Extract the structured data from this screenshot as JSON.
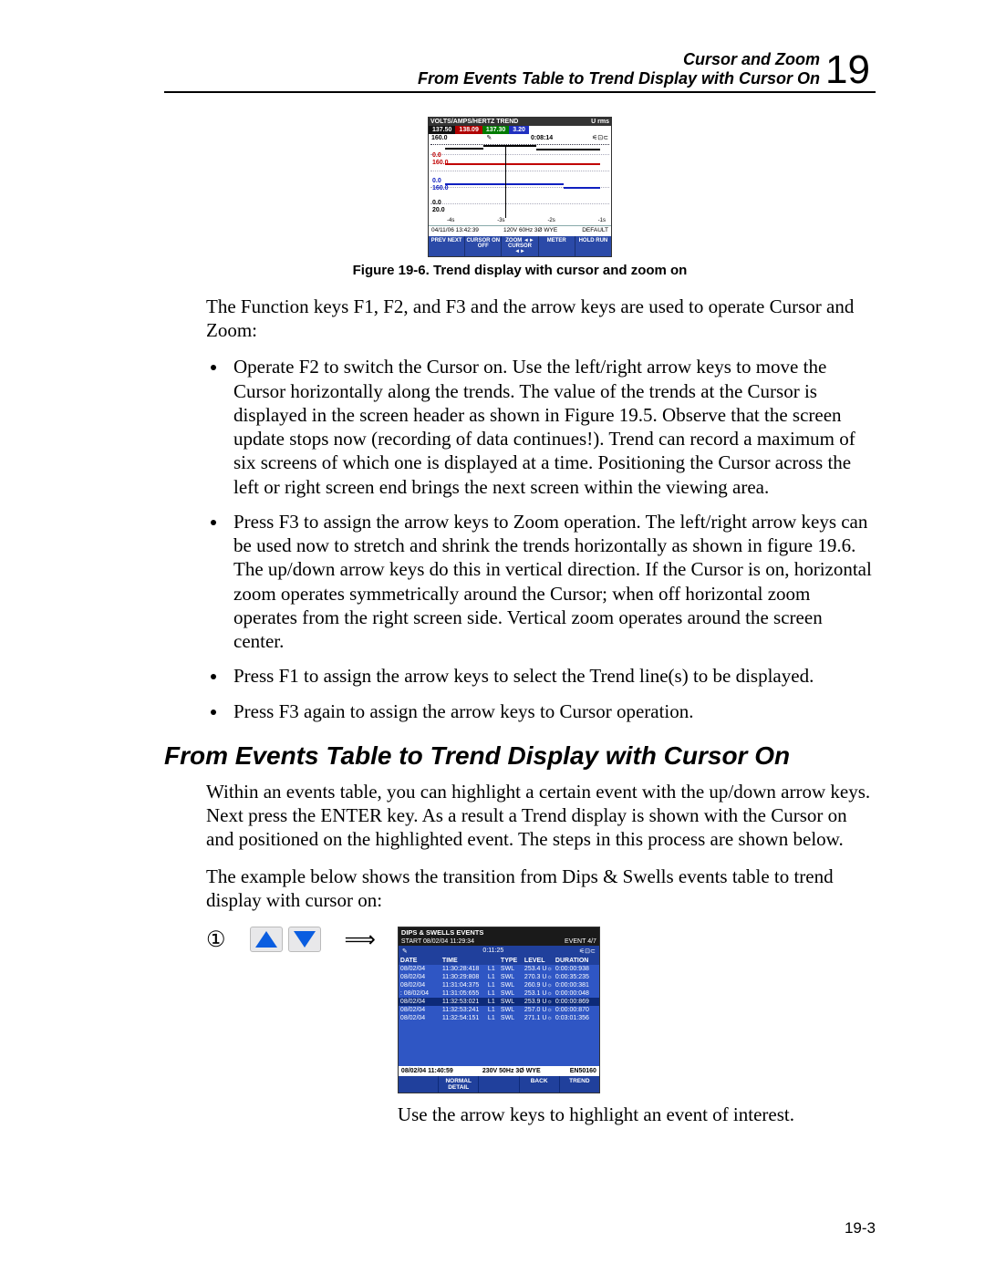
{
  "header": {
    "line1": "Cursor and Zoom",
    "line2": "From Events Table to Trend Display with Cursor On",
    "chapter_number": "19"
  },
  "figure1": {
    "caption": "Figure 19-6. Trend display with cursor and zoom on",
    "title": "VOLTS/AMPS/HERTZ TREND",
    "u_label": "U rms",
    "vals": [
      "137.50",
      "138.09",
      "137.30",
      "3.20"
    ],
    "plot_top_row": {
      "left_label": "160.0",
      "cursor_icon": "✎",
      "time": "0:08:14",
      "batt": "⚟⊡⊂"
    },
    "y_labels": [
      "0.0",
      "160.0",
      "0.0",
      "160.0",
      "0.0",
      "20.0"
    ],
    "x_row": [
      "-4s",
      "-3s",
      "-2s",
      "-1s"
    ],
    "status": {
      "datetime": "04/11/06 13:42:39",
      "sys": "120V 60Hz 3Ø WYE",
      "cfg": "DEFAULT"
    },
    "softkeys": [
      "PREV NEXT",
      "CURSOR ON OFF",
      "ZOOM ◄►\nCURSOR ◄►",
      "METER",
      "HOLD RUN"
    ]
  },
  "intro_para": "The Function keys F1, F2, and F3 and the arrow keys are used to operate Cursor and Zoom:",
  "bullets": [
    "Operate F2 to switch the Cursor on. Use the left/right arrow keys to move the Cursor horizontally along the trends. The value of the trends at the Cursor is displayed in the screen header as shown in Figure 19.5. Observe that the screen update stops now (recording of data continues!). Trend can record a maximum of six screens of which one is displayed at a time. Positioning the Cursor across the left or right screen end brings the next screen within the viewing area.",
    "Press F3 to assign the arrow keys to Zoom operation. The left/right arrow keys can be used now to stretch and shrink the trends horizontally as shown in figure 19.6. The up/down arrow keys do this in vertical direction. If the Cursor is on, horizontal zoom operates symmetrically around the Cursor; when off horizontal zoom operates from the right screen side. Vertical zoom operates around the screen center.",
    "Press F1 to assign the arrow keys to select the Trend line(s) to be displayed.",
    "Press F3 again to assign the arrow keys to Cursor operation."
  ],
  "section_heading": "From Events Table to Trend Display with Cursor On",
  "section_p1": "Within an events table, you can highlight a certain event with the up/down arrow keys. Next press the ENTER key. As a result a Trend display is shown with the Cursor on and positioned on the highlighted event. The steps in this process are shown below.",
  "section_p2": "The example below shows the transition from Dips & Swells events table to trend display with cursor on:",
  "step_marker": "①",
  "events": {
    "title": "DIPS & SWELLS EVENTS",
    "start": "START 08/02/04 11:29:34",
    "meta_time": "0:11:25",
    "meta_event": "EVENT  4/7",
    "meta_batt": "⚟⊡⊂",
    "cols": [
      "DATE",
      "TIME",
      "",
      "TYPE",
      "LEVEL",
      "DURATION"
    ],
    "rows": [
      {
        "d": "08/02/04",
        "t": "11:30:28:418",
        "p": "L1",
        "ty": "SWL",
        "lv": "253.4 U☼",
        "du": "0:00:00:938"
      },
      {
        "d": "08/02/04",
        "t": "11:30:29:808",
        "p": "L1",
        "ty": "SWL",
        "lv": "270.3 U☼",
        "du": "0:00:35:235"
      },
      {
        "d": "08/02/04",
        "t": "11:31:04:375",
        "p": "L1",
        "ty": "SWL",
        "lv": "260.9 U☼",
        "du": "0:00:00:381"
      },
      {
        "d": "08/02/04",
        "t": "11:31:05:655",
        "p": "L1",
        "ty": "SWL",
        "lv": "253.1 U☼",
        "du": "0:00:00:048",
        "marker": ":"
      },
      {
        "d": "08/02/04",
        "t": "11:32:53:021",
        "p": "L1",
        "ty": "SWL",
        "lv": "253.9 U☼",
        "du": "0:00:00:869",
        "sel": true
      },
      {
        "d": "08/02/04",
        "t": "11:32:53:241",
        "p": "L1",
        "ty": "SWL",
        "lv": "257.0 U☼",
        "du": "0:00:00:870"
      },
      {
        "d": "08/02/04",
        "t": "11:32:54:151",
        "p": "L1",
        "ty": "SWL",
        "lv": "271.1 U☼",
        "du": "0:03:01:356"
      }
    ],
    "status": {
      "datetime": "08/02/04 11:40:59",
      "sys": "230V 50Hz 3Ø WYE",
      "cfg": "EN50160"
    },
    "softkeys": [
      "",
      "NORMAL DETAIL",
      "",
      "BACK",
      "TREND"
    ]
  },
  "step_instruction": "Use the arrow keys to highlight an event of interest.",
  "page_number": "19-3"
}
